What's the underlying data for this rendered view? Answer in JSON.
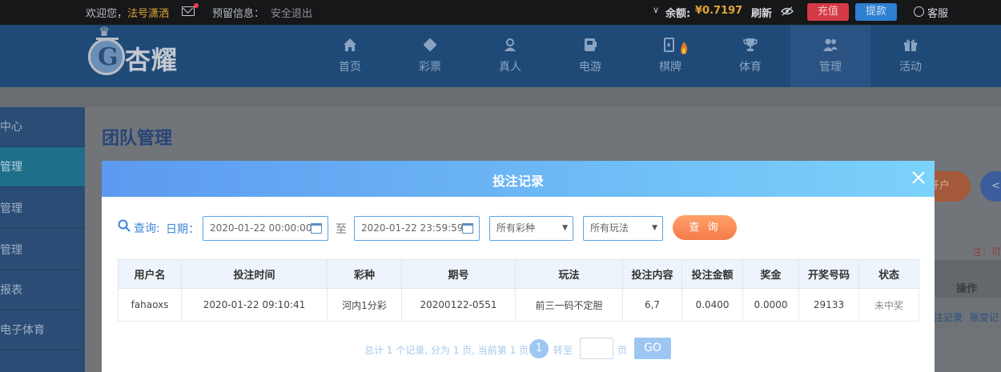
{
  "topbar": {
    "welcome": "欢迎您，",
    "username": "法号潇洒",
    "reserve_info": "预留信息：",
    "logout": "安全退出",
    "chevron": "∨",
    "balance_label": "余额:",
    "balance_value": "¥0.7197",
    "refresh": "刷新",
    "recharge": "充值",
    "withdraw": "提款",
    "customer_service": "客服",
    "colors": {
      "username": "#e0a53a",
      "recharge": "#d33a45",
      "withdraw": "#2d7fd0"
    }
  },
  "header": {
    "logo_text": "杏耀",
    "nav": [
      {
        "label": "首页",
        "icon": "home-icon"
      },
      {
        "label": "彩票",
        "icon": "lottery-ticket-icon"
      },
      {
        "label": "真人",
        "icon": "live-dealer-icon"
      },
      {
        "label": "电游",
        "icon": "slot-machine-icon"
      },
      {
        "label": "棋牌",
        "icon": "cards-icon"
      },
      {
        "label": "体育",
        "icon": "trophy-icon"
      },
      {
        "label": "管理",
        "icon": "users-icon"
      },
      {
        "label": "活动",
        "icon": "gift-icon"
      }
    ]
  },
  "sidebar": {
    "items": [
      {
        "label": "理中心"
      },
      {
        "label": "人管理"
      },
      {
        "label": "人管理"
      },
      {
        "label": "资管理"
      },
      {
        "label": "票报表"
      },
      {
        "label": "人电子体育"
      }
    ]
  },
  "background": {
    "page_title": "团队管理",
    "open_account": "开户",
    "note": "注：可",
    "col_op": "操作",
    "link_bet_records": "注记录",
    "link_account_changes": "账变记"
  },
  "modal": {
    "title": "投注记录",
    "query_label": "查询:",
    "date_label": "日期：",
    "date_start": "2020-01-22 00:00:00",
    "date_to": "至",
    "date_end": "2020-01-22 23:59:59",
    "lottery_select": "所有彩种",
    "method_select": "所有玩法",
    "query_button": "查 询",
    "table": {
      "headers": [
        "用户名",
        "投注时间",
        "彩种",
        "期号",
        "玩法",
        "投注内容",
        "投注金额",
        "奖金",
        "开奖号码",
        "状态"
      ],
      "rows": [
        [
          "fahaoxs",
          "2020-01-22 09:10:41",
          "河内1分彩",
          "20200122-0551",
          "前三一码不定胆",
          "6,7",
          "0.0400",
          "0.0000",
          "29133",
          "未中奖"
        ]
      ]
    },
    "pager": {
      "summary": "总计 1 个记录, 分为 1 页, 当前第 1 页",
      "current_page": "1",
      "goto_label": "转至",
      "page_unit": "页",
      "go_button": "GO"
    }
  }
}
